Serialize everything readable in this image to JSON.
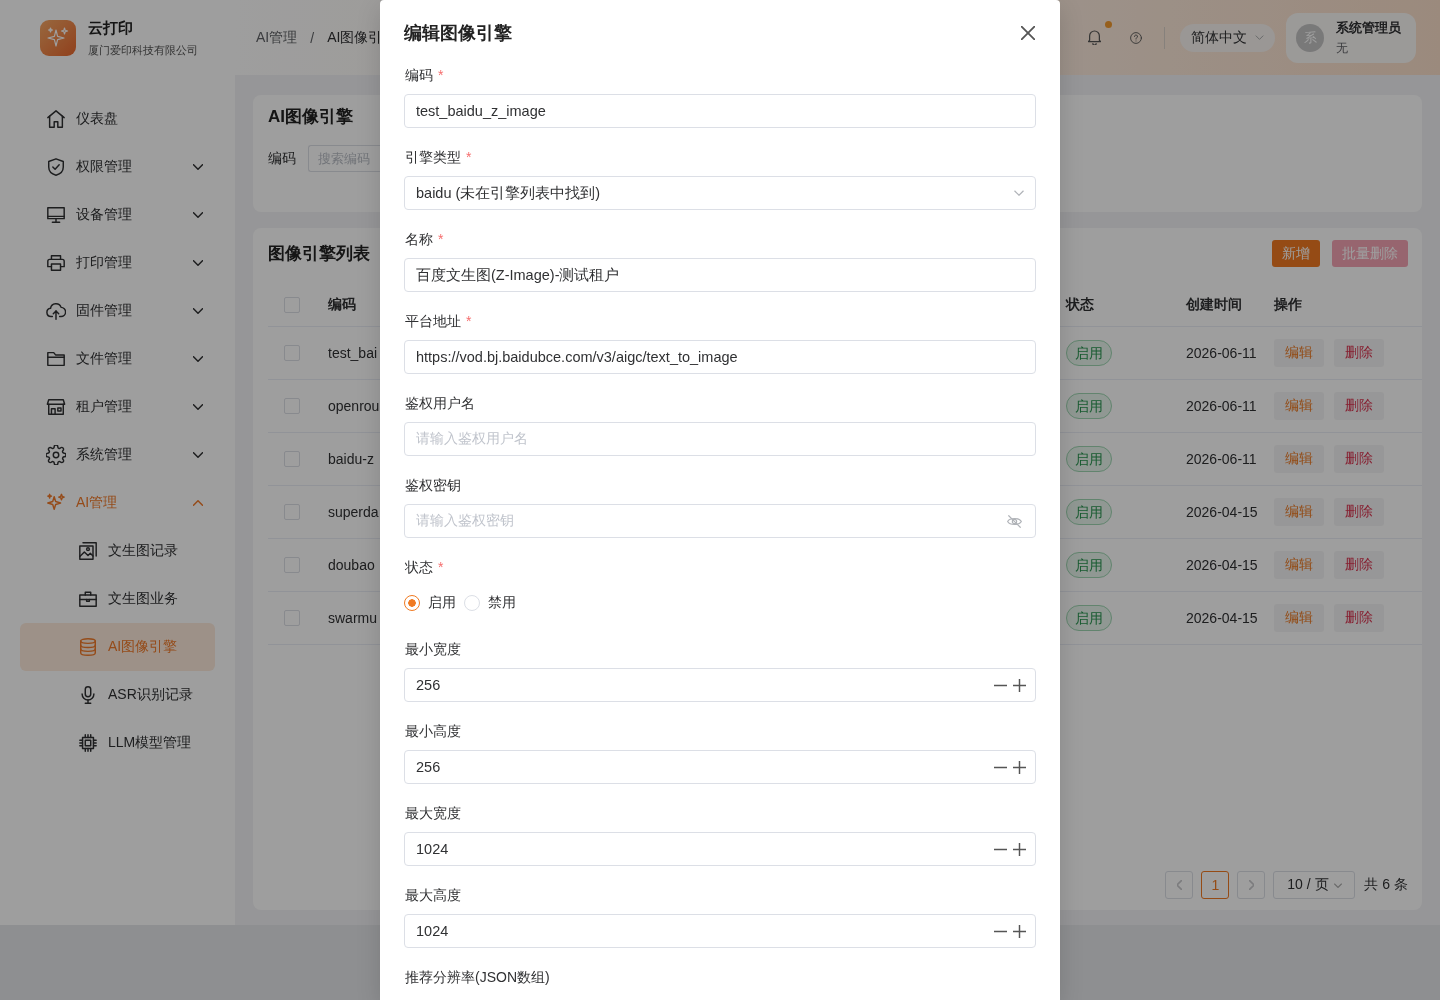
{
  "sidebar": {
    "brand": {
      "title": "云打印",
      "subtitle": "厦门爱印科技有限公司"
    },
    "items": [
      {
        "label": "仪表盘",
        "kind": "link",
        "selected": false
      },
      {
        "label": "权限管理",
        "kind": "group",
        "selected": false,
        "expanded": false
      },
      {
        "label": "设备管理",
        "kind": "group",
        "selected": false,
        "expanded": false
      },
      {
        "label": "打印管理",
        "kind": "group",
        "selected": false,
        "expanded": false
      },
      {
        "label": "固件管理",
        "kind": "group",
        "selected": false,
        "expanded": false
      },
      {
        "label": "文件管理",
        "kind": "group",
        "selected": false,
        "expanded": false
      },
      {
        "label": "租户管理",
        "kind": "group",
        "selected": false,
        "expanded": false
      },
      {
        "label": "系统管理",
        "kind": "group",
        "selected": false,
        "expanded": false
      },
      {
        "label": "AI管理",
        "kind": "group",
        "selected": false,
        "expanded": true,
        "children": [
          {
            "label": "文生图记录",
            "selected": false
          },
          {
            "label": "文生图业务",
            "selected": false
          },
          {
            "label": "AI图像引擎",
            "selected": true
          },
          {
            "label": "ASR识别记录",
            "selected": false
          },
          {
            "label": "LLM模型管理",
            "selected": false
          }
        ]
      }
    ]
  },
  "header": {
    "breadcrumb": {
      "items": [
        "AI管理",
        "AI图像引"
      ],
      "separator": "/"
    },
    "has_unread": true,
    "language": "简体中文",
    "user": {
      "avatar": "系",
      "name": "系统管理员",
      "role": "无"
    }
  },
  "search_card": {
    "title": "AI图像引擎",
    "filters": [
      {
        "label": "编码",
        "placeholder": "搜索编码"
      }
    ]
  },
  "list_card": {
    "title": "图像引擎列表",
    "buttons": [
      {
        "label": "新增",
        "kind": "primary",
        "disabled": false
      },
      {
        "label": "批量删除",
        "kind": "danger",
        "disabled": true
      }
    ],
    "table": {
      "header_checked": false,
      "columns": [
        "编码",
        "状态",
        "创建时间",
        "操作"
      ],
      "rows": [
        {
          "checked": false,
          "code": "test_bai",
          "status": "启用",
          "created": "2026-06-11",
          "actions": [
            {
              "label": "编辑",
              "kind": "edit"
            },
            {
              "label": "删除",
              "kind": "delete"
            }
          ]
        },
        {
          "checked": false,
          "code": "openrou",
          "status": "启用",
          "created": "2026-06-11",
          "actions": [
            {
              "label": "编辑",
              "kind": "edit"
            },
            {
              "label": "删除",
              "kind": "delete"
            }
          ]
        },
        {
          "checked": false,
          "code": "baidu-z",
          "status": "启用",
          "created": "2026-06-11",
          "actions": [
            {
              "label": "编辑",
              "kind": "edit"
            },
            {
              "label": "删除",
              "kind": "delete"
            }
          ]
        },
        {
          "checked": false,
          "code": "superda",
          "status": "启用",
          "created": "2026-04-15",
          "actions": [
            {
              "label": "编辑",
              "kind": "edit"
            },
            {
              "label": "删除",
              "kind": "delete"
            }
          ]
        },
        {
          "checked": false,
          "code": "doubao",
          "status": "启用",
          "created": "2026-04-15",
          "actions": [
            {
              "label": "编辑",
              "kind": "edit"
            },
            {
              "label": "删除",
              "kind": "delete"
            }
          ]
        },
        {
          "checked": false,
          "code": "swarmu",
          "status": "启用",
          "created": "2026-04-15",
          "actions": [
            {
              "label": "编辑",
              "kind": "edit"
            },
            {
              "label": "删除",
              "kind": "delete"
            }
          ]
        }
      ]
    },
    "pagination": {
      "prev_disabled": true,
      "next_disabled": true,
      "pages": [
        {
          "label": "1",
          "selected": true
        }
      ],
      "page_size": "10 / 页",
      "total": "共 6 条"
    }
  },
  "dialog": {
    "title": "编辑图像引擎",
    "required_marker": "*",
    "fields": [
      {
        "label": "编码",
        "required": true,
        "kind": "text",
        "value": "test_baidu_z_image"
      },
      {
        "label": "引擎类型",
        "required": true,
        "kind": "select",
        "value": "baidu (未在引擎列表中找到)"
      },
      {
        "label": "名称",
        "required": true,
        "kind": "text",
        "value": "百度文生图(Z-Image)-测试租户"
      },
      {
        "label": "平台地址",
        "required": true,
        "kind": "text",
        "value": "https://vod.bj.baidubce.com/v3/aigc/text_to_image"
      },
      {
        "label": "鉴权用户名",
        "required": false,
        "kind": "text",
        "placeholder": "请输入鉴权用户名"
      },
      {
        "label": "鉴权密钥",
        "required": false,
        "kind": "password",
        "placeholder": "请输入鉴权密钥"
      },
      {
        "label": "状态",
        "required": true,
        "kind": "radio",
        "options": [
          {
            "label": "启用",
            "selected": true
          },
          {
            "label": "禁用",
            "selected": false
          }
        ]
      },
      {
        "label": "最小宽度",
        "required": false,
        "kind": "number",
        "value": "256"
      },
      {
        "label": "最小高度",
        "required": false,
        "kind": "number",
        "value": "256"
      },
      {
        "label": "最大宽度",
        "required": false,
        "kind": "number",
        "value": "1024"
      },
      {
        "label": "最大高度",
        "required": false,
        "kind": "number",
        "value": "1024"
      },
      {
        "label": "推荐分辨率(JSON数组)",
        "required": false,
        "kind": "label"
      }
    ]
  }
}
